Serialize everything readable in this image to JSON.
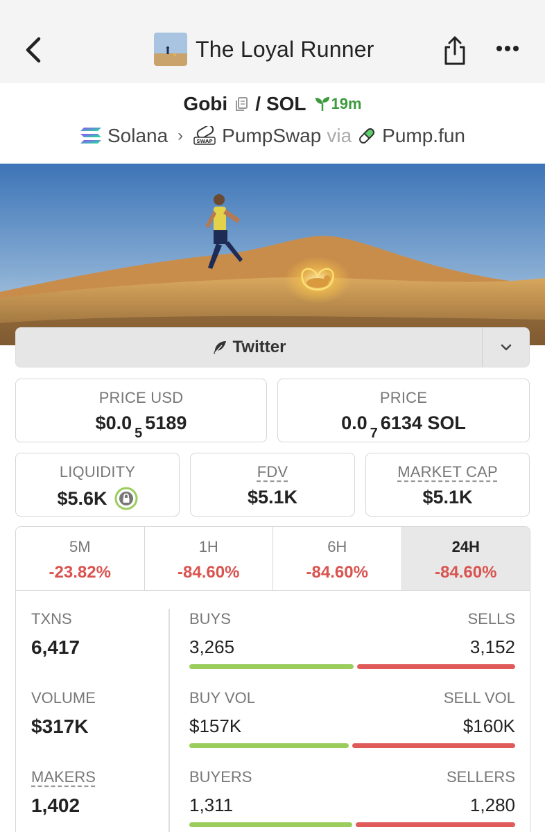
{
  "header": {
    "title": "The Loyal Runner",
    "back_icon": "chevron-left-icon",
    "share_icon": "share-icon",
    "more_icon": "more-icon"
  },
  "pair": {
    "base": "Gobi",
    "separator": "/",
    "quote": "SOL",
    "age": "19m",
    "chain": "Solana",
    "dex": "PumpSwap",
    "via": "via",
    "launchpad": "Pump.fun"
  },
  "links": {
    "twitter_label": "Twitter"
  },
  "prices": {
    "price_usd_label": "PRICE USD",
    "price_usd_prefix": "$0.0",
    "price_usd_zeros": "5",
    "price_usd_digits": "5189",
    "price_label": "PRICE",
    "price_prefix": "0.0",
    "price_zeros": "7",
    "price_digits": "6134 SOL"
  },
  "metrics": {
    "liquidity_label": "LIQUIDITY",
    "liquidity_value": "$5.6K",
    "fdv_label": "FDV",
    "fdv_value": "$5.1K",
    "mcap_label": "MARKET CAP",
    "mcap_value": "$5.1K"
  },
  "timeframes": [
    {
      "label": "5M",
      "change": "-23.82%"
    },
    {
      "label": "1H",
      "change": "-84.60%"
    },
    {
      "label": "6H",
      "change": "-84.60%"
    },
    {
      "label": "24H",
      "change": "-84.60%"
    }
  ],
  "active_timeframe": "24H",
  "stats": {
    "txns_label": "TXNS",
    "txns_value": "6,417",
    "volume_label": "VOLUME",
    "volume_value": "$317K",
    "makers_label": "MAKERS",
    "makers_value": "1,402",
    "buys_label": "BUYS",
    "buys_value": "3,265",
    "sells_label": "SELLS",
    "sells_value": "3,152",
    "buy_vol_label": "BUY VOL",
    "buy_vol_value": "$157K",
    "sell_vol_label": "SELL VOL",
    "sell_vol_value": "$160K",
    "buyers_label": "BUYERS",
    "buyers_value": "1,311",
    "sellers_label": "SELLERS",
    "sellers_value": "1,280",
    "buys_ratio": 0.509,
    "buy_vol_ratio": 0.495,
    "buyers_ratio": 0.506
  },
  "colors": {
    "positive": "#9acd5b",
    "negative": "#e05a5a",
    "age_green": "#3d9a3d"
  }
}
